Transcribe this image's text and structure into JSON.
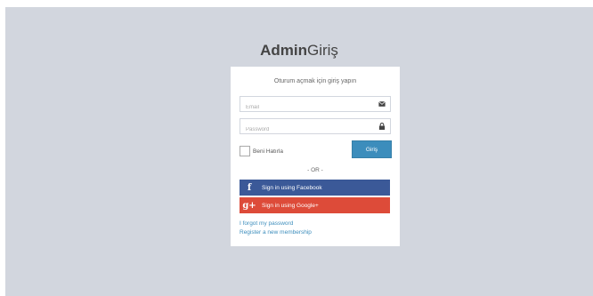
{
  "logo": {
    "bold": "Admin",
    "light": "Giriş"
  },
  "login": {
    "message": "Oturum açmak için giriş yapın",
    "email_placeholder": "Email",
    "password_placeholder": "Password",
    "remember_label": "Beni Hatırla",
    "submit_label": "Giriş",
    "or_label": "- OR -",
    "facebook_label": "Sign in using Facebook",
    "google_label": "Sign in using Google+",
    "forgot_link": "I forgot my password",
    "register_link": "Register a new membership"
  },
  "icons": {
    "email": "envelope-icon",
    "password": "lock-icon",
    "facebook": "facebook-icon",
    "google": "google-plus-icon"
  },
  "colors": {
    "background": "#d2d6de",
    "primary": "#3c8dbc",
    "facebook": "#3b5998",
    "google": "#dd4b39"
  }
}
